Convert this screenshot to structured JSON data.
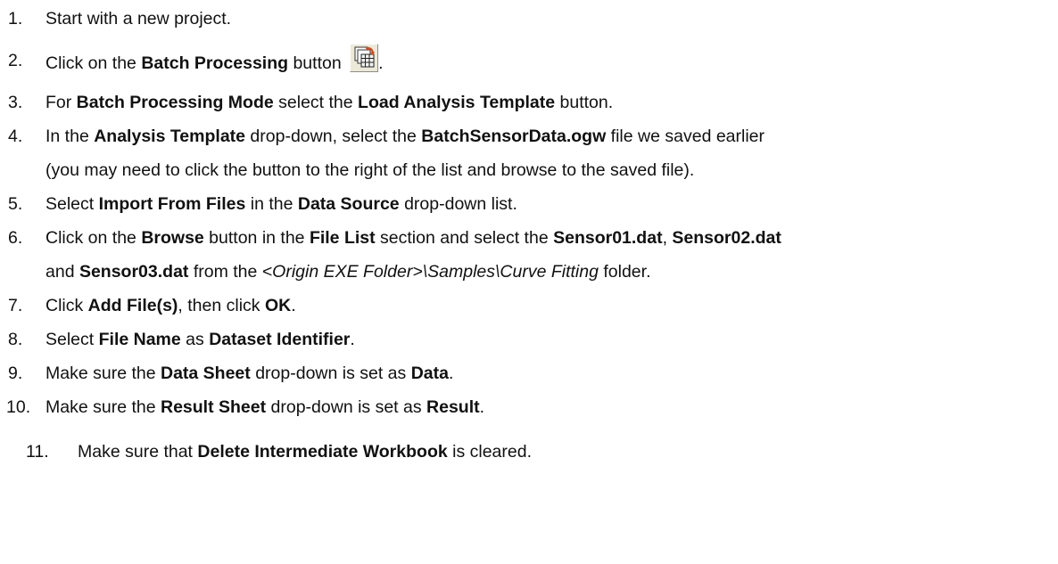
{
  "steps": [
    {
      "number": "1.",
      "parts": [
        {
          "text": "Start with a new project.",
          "style": "normal"
        }
      ]
    },
    {
      "number": "2.",
      "parts": [
        {
          "text": "Click on the ",
          "style": "normal"
        },
        {
          "text": "Batch Processing",
          "style": "bold"
        },
        {
          "text": " button ",
          "style": "normal"
        },
        {
          "icon": "batch-processing-icon"
        },
        {
          "text": ".",
          "style": "normal"
        }
      ]
    },
    {
      "number": "3.",
      "parts": [
        {
          "text": "For ",
          "style": "normal"
        },
        {
          "text": "Batch Processing Mode",
          "style": "bold"
        },
        {
          "text": " select the ",
          "style": "normal"
        },
        {
          "text": "Load Analysis Template",
          "style": "bold"
        },
        {
          "text": " button.",
          "style": "normal"
        }
      ]
    },
    {
      "number": "4.",
      "parts": [
        {
          "text": "In the ",
          "style": "normal"
        },
        {
          "text": "Analysis Template",
          "style": "bold"
        },
        {
          "text": " drop-down, select the ",
          "style": "normal"
        },
        {
          "text": "BatchSensorData.ogw",
          "style": "bold"
        },
        {
          "text": " file we saved earlier",
          "style": "normal"
        }
      ],
      "continuation": [
        {
          "text": "(you may need to click the button to the right of the list and browse to the saved file).",
          "style": "normal"
        }
      ]
    },
    {
      "number": "5.",
      "parts": [
        {
          "text": "Select ",
          "style": "normal"
        },
        {
          "text": "Import From Files",
          "style": "bold"
        },
        {
          "text": " in the ",
          "style": "normal"
        },
        {
          "text": "Data Source",
          "style": "bold"
        },
        {
          "text": " drop-down list.",
          "style": "normal"
        }
      ]
    },
    {
      "number": "6.",
      "parts": [
        {
          "text": "Click on the ",
          "style": "normal"
        },
        {
          "text": "Browse",
          "style": "bold"
        },
        {
          "text": " button in the ",
          "style": "normal"
        },
        {
          "text": "File List",
          "style": "bold"
        },
        {
          "text": " section and select the ",
          "style": "normal"
        },
        {
          "text": "Sensor01.dat",
          "style": "bold"
        },
        {
          "text": ", ",
          "style": "normal"
        },
        {
          "text": "Sensor02.dat",
          "style": "bold"
        }
      ],
      "continuation": [
        {
          "text": "and ",
          "style": "normal"
        },
        {
          "text": "Sensor03.dat",
          "style": "bold"
        },
        {
          "text": " from the ",
          "style": "normal"
        },
        {
          "text": "<Origin EXE Folder>\\Samples\\Curve Fitting",
          "style": "italic"
        },
        {
          "text": " folder.",
          "style": "normal"
        }
      ]
    },
    {
      "number": "7.",
      "parts": [
        {
          "text": "Click ",
          "style": "normal"
        },
        {
          "text": "Add File(s)",
          "style": "bold"
        },
        {
          "text": ", then click ",
          "style": "normal"
        },
        {
          "text": "OK",
          "style": "bold"
        },
        {
          "text": ".",
          "style": "normal"
        }
      ]
    },
    {
      "number": "8.",
      "parts": [
        {
          "text": "Select ",
          "style": "normal"
        },
        {
          "text": "File Name",
          "style": "bold"
        },
        {
          "text": " as ",
          "style": "normal"
        },
        {
          "text": "Dataset Identifier",
          "style": "bold"
        },
        {
          "text": ".",
          "style": "normal"
        }
      ]
    },
    {
      "number": "9.",
      "parts": [
        {
          "text": "Make sure the ",
          "style": "normal"
        },
        {
          "text": "Data Sheet",
          "style": "bold"
        },
        {
          "text": " drop-down is set as ",
          "style": "normal"
        },
        {
          "text": "Data",
          "style": "bold"
        },
        {
          "text": ".",
          "style": "normal"
        }
      ]
    },
    {
      "number": "10.",
      "parts": [
        {
          "text": "Make sure the ",
          "style": "normal"
        },
        {
          "text": "Result Sheet",
          "style": "bold"
        },
        {
          "text": " drop-down is set as ",
          "style": "normal"
        },
        {
          "text": "Result",
          "style": "bold"
        },
        {
          "text": ".",
          "style": "normal"
        }
      ]
    },
    {
      "number": "11.",
      "parts": [
        {
          "text": "Make sure that ",
          "style": "normal"
        },
        {
          "text": "Delete Intermediate Workbook",
          "style": "bold"
        },
        {
          "text": " is cleared.",
          "style": "normal"
        }
      ]
    }
  ]
}
